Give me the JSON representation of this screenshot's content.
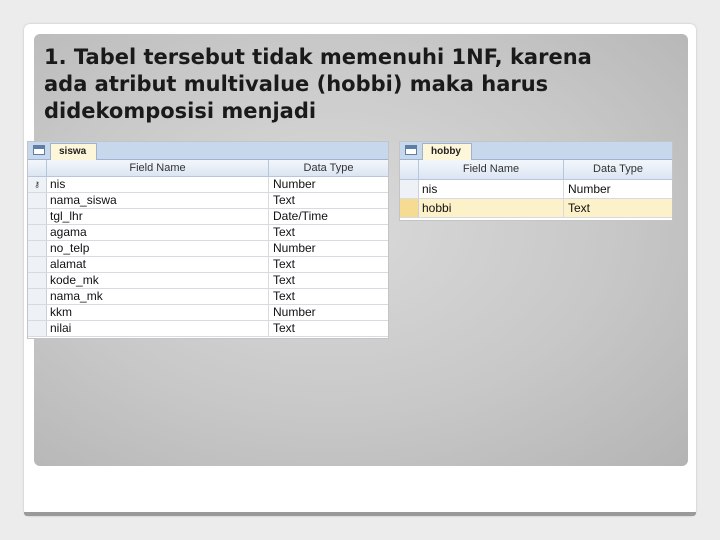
{
  "slide": {
    "title": "1. Tabel tersebut tidak memenuhi 1NF, karena\nada atribut multivalue (hobbi) maka harus\ndidekomposisi menjadi"
  },
  "table_siswa": {
    "tab_label": "siswa",
    "columns": [
      "Field Name",
      "Data Type"
    ],
    "rows": [
      {
        "field": "nis",
        "type": "Number",
        "key": true
      },
      {
        "field": "nama_siswa",
        "type": "Text"
      },
      {
        "field": "tgl_lhr",
        "type": "Date/Time"
      },
      {
        "field": "agama",
        "type": "Text"
      },
      {
        "field": "no_telp",
        "type": "Number"
      },
      {
        "field": "alamat",
        "type": "Text"
      },
      {
        "field": "kode_mk",
        "type": "Text"
      },
      {
        "field": "nama_mk",
        "type": "Text"
      },
      {
        "field": "kkm",
        "type": "Number"
      },
      {
        "field": "nilai",
        "type": "Text"
      }
    ]
  },
  "table_hobby": {
    "tab_label": "hobby",
    "columns": [
      "Field Name",
      "Data Type"
    ],
    "rows": [
      {
        "field": "nis",
        "type": "Number"
      },
      {
        "field": "hobbi",
        "type": "Text",
        "current": true
      }
    ]
  },
  "icons": {
    "table_tab": "table-icon",
    "primary_key": "key-icon"
  }
}
